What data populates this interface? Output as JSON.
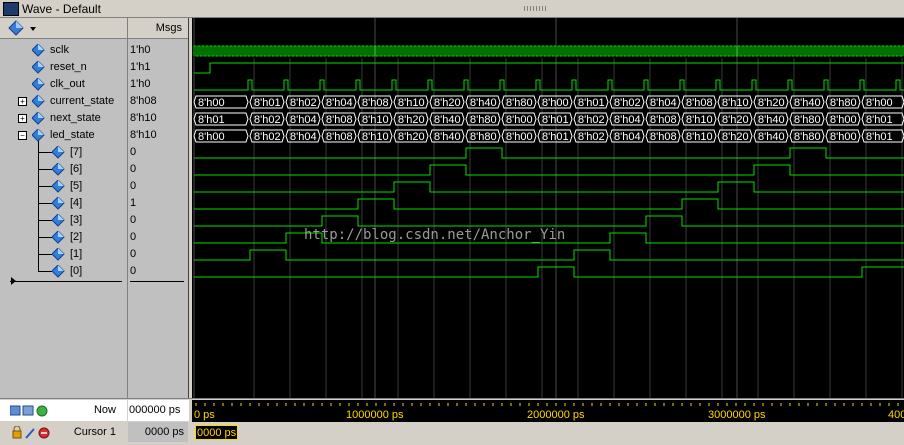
{
  "window": {
    "title": "Wave - Default"
  },
  "columns": {
    "msgs": "Msgs"
  },
  "signals": [
    {
      "name": "sclk",
      "value": "1'h0"
    },
    {
      "name": "reset_n",
      "value": "1'h1"
    },
    {
      "name": "clk_out",
      "value": "1'h0"
    },
    {
      "name": "current_state",
      "value": "8'h08",
      "expand": "+"
    },
    {
      "name": "next_state",
      "value": "8'h10",
      "expand": "+"
    },
    {
      "name": "led_state",
      "value": "8'h10",
      "expand": "-"
    },
    {
      "name": "[7]",
      "value": "0"
    },
    {
      "name": "[6]",
      "value": "0"
    },
    {
      "name": "[5]",
      "value": "0"
    },
    {
      "name": "[4]",
      "value": "1"
    },
    {
      "name": "[3]",
      "value": "0"
    },
    {
      "name": "[2]",
      "value": "0"
    },
    {
      "name": "[1]",
      "value": "0"
    },
    {
      "name": "[0]",
      "value": "0"
    }
  ],
  "bus_values": {
    "current_state": [
      "8'h00",
      "8'h01",
      "8'h02",
      "8'h04",
      "8'h08",
      "8'h10",
      "8'h20",
      "8'h40",
      "8'h80",
      "8'h00",
      "8'h01",
      "8'h02",
      "8'h04",
      "8'h08",
      "8'h10",
      "8'h20",
      "8'h40",
      "8'h80",
      "8'h00"
    ],
    "next_state": [
      "8'h01",
      "8'h02",
      "8'h04",
      "8'h08",
      "8'h10",
      "8'h20",
      "8'h40",
      "8'h80",
      "8'h00",
      "8'h01",
      "8'h02",
      "8'h04",
      "8'h08",
      "8'h10",
      "8'h20",
      "8'h40",
      "8'h80",
      "8'h00",
      "8'h01"
    ],
    "led_state": [
      "8'h00",
      "8'h02",
      "8'h04",
      "8'h08",
      "8'h10",
      "8'h20",
      "8'h40",
      "8'h80",
      "8'h00",
      "8'h01",
      "8'h02",
      "8'h04",
      "8'h08",
      "8'h10",
      "8'h20",
      "8'h40",
      "8'h80",
      "8'h00",
      "8'h01"
    ]
  },
  "watermark": "http://blog.csdn.net/Anchor_Yin",
  "footer": {
    "now_label": "Now",
    "now_value": "000000 ps",
    "cursor_label": "Cursor 1",
    "cursor_value": "0000 ps",
    "cursor_time": "0000 ps"
  },
  "timeline": {
    "labels": [
      "0 ps",
      "1000000 ps",
      "2000000 ps",
      "3000000 ps",
      "400"
    ]
  },
  "colors": {
    "wave": "#00e000",
    "cursor": "#ffd800",
    "background": "#000000"
  }
}
